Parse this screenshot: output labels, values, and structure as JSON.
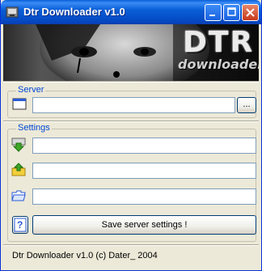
{
  "window": {
    "title": "Dtr Downloader v1.0"
  },
  "banner": {
    "logo_main": "DTR",
    "logo_sub": "downloader"
  },
  "server_group": {
    "label": "Server",
    "server_value": "",
    "browse_label": "..."
  },
  "settings_group": {
    "label": "Settings",
    "field1_value": "",
    "field2_value": "",
    "field3_value": ""
  },
  "save_button": {
    "label": "Save server settings !"
  },
  "help_button": {
    "label": "?"
  },
  "statusbar": {
    "text": "Dtr Downloader v1.0 (c) Dater_ 2004"
  },
  "colors": {
    "title_blue": "#0a5fd8",
    "group_label": "#0046d5",
    "face": "#ece9d8"
  }
}
